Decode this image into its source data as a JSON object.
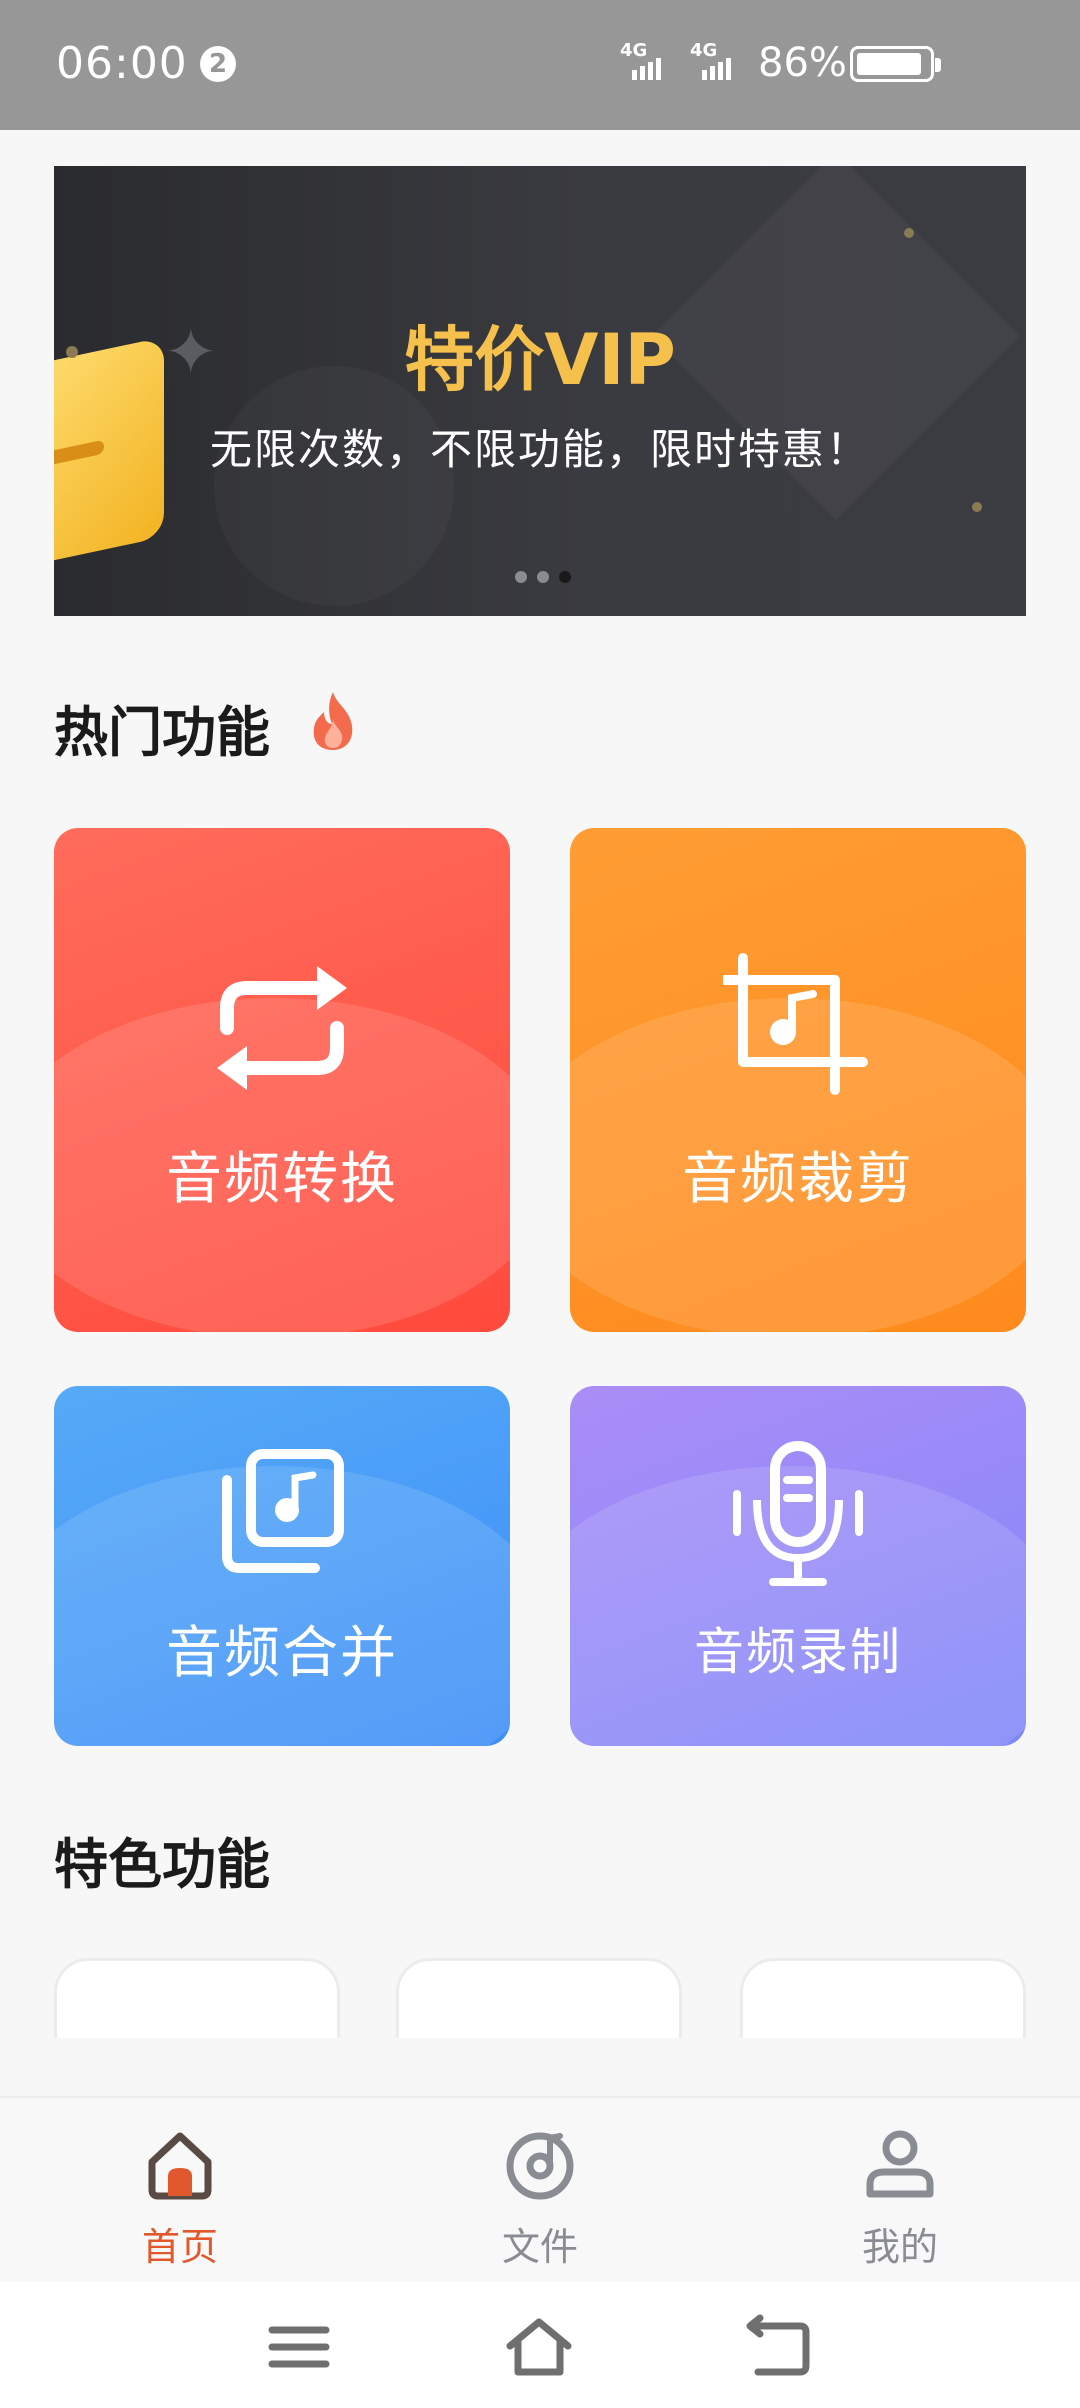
{
  "status_bar": {
    "time": "06:00",
    "notification_count": "2",
    "network_1": "4G",
    "network_2": "4G",
    "battery_percent": "86%",
    "battery_level": 0.86
  },
  "banner": {
    "title": "特价VIP",
    "subtitle": "无限次数，不限功能，限时特惠！",
    "page_count": 3,
    "active_page_index": 2
  },
  "hot_section": {
    "title": "热门功能",
    "icon": "fire-icon"
  },
  "hot_features": [
    {
      "label": "音频转换",
      "icon": "convert-icon",
      "color": "#ff5a4a"
    },
    {
      "label": "音频裁剪",
      "icon": "crop-music-icon",
      "color": "#ff9428"
    },
    {
      "label": "音频合并",
      "icon": "merge-music-icon",
      "color": "#4a9cf7"
    },
    {
      "label": "音频录制",
      "icon": "microphone-icon",
      "color": "#9589f8"
    }
  ],
  "special_section": {
    "title": "特色功能"
  },
  "tabs": [
    {
      "label": "首页",
      "icon": "home-icon",
      "active": true
    },
    {
      "label": "文件",
      "icon": "music-disc-icon",
      "active": false
    },
    {
      "label": "我的",
      "icon": "user-icon",
      "active": false
    }
  ],
  "colors": {
    "accent": "#e1582c",
    "tab_inactive": "#8a8c94",
    "banner_title": "#f5c14c"
  }
}
